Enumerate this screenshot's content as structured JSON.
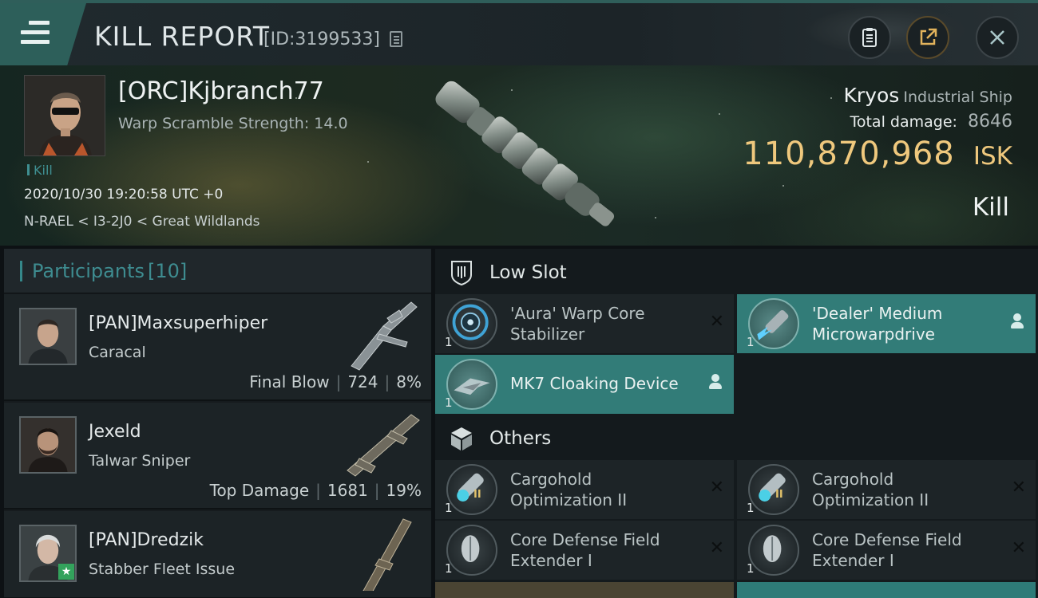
{
  "header": {
    "title": "KILL REPORT",
    "report_id": "[ID:3199533]"
  },
  "victim": {
    "name": "[ORC]Kjbranch77",
    "warp_scramble": "Warp Scramble Strength: 14.0",
    "tag": "Kill",
    "datetime": "2020/10/30 19:20:58 UTC +0",
    "location": "N-RAEL < I3-2J0 < Great Wildlands",
    "ship_name": "Kryos",
    "ship_class": "Industrial Ship",
    "total_damage_label": "Total damage:",
    "total_damage": "8646",
    "isk_value": "110,870,968",
    "isk_unit": "ISK",
    "result": "Kill"
  },
  "participants": {
    "label": "Participants",
    "count": "[10]",
    "items": [
      {
        "name": "[PAN]Maxsuperhiper",
        "ship": "Caracal",
        "role": "Final Blow",
        "damage": "724",
        "percent": "8%"
      },
      {
        "name": "Jexeld",
        "ship": "Talwar Sniper",
        "role": "Top Damage",
        "damage": "1681",
        "percent": "19%"
      },
      {
        "name": "[PAN]Dredzik",
        "ship": "Stabber Fleet Issue",
        "role": "",
        "damage": "",
        "percent": ""
      }
    ]
  },
  "low_slot": {
    "label": "Low Slot",
    "items": [
      {
        "name_line1": "'Aura' Warp Core",
        "name_line2": "Stabilizer",
        "qty": "1",
        "status": "destroyed"
      },
      {
        "name_line1": "'Dealer' Medium",
        "name_line2": "Microwarpdrive",
        "qty": "1",
        "status": "dropped"
      },
      {
        "name_line1": "MK7 Cloaking Device",
        "name_line2": "",
        "qty": "1",
        "status": "dropped"
      }
    ]
  },
  "others": {
    "label": "Others",
    "items": [
      {
        "name_line1": "Cargohold",
        "name_line2": "Optimization II",
        "qty": "1",
        "tier": "II",
        "status": "destroyed"
      },
      {
        "name_line1": "Cargohold",
        "name_line2": "Optimization II",
        "qty": "1",
        "tier": "II",
        "status": "destroyed"
      },
      {
        "name_line1": "Core Defense Field",
        "name_line2": "Extender I",
        "qty": "1",
        "status": "destroyed"
      },
      {
        "name_line1": "Core Defense Field",
        "name_line2": "Extender I",
        "qty": "1",
        "status": "destroyed"
      }
    ]
  },
  "colors": {
    "accent_teal": "#327c78",
    "isk_gold": "#efc87d",
    "participants_teal": "#3e8c90"
  },
  "icons": [
    "menu-icon",
    "copy-icon",
    "clipboard-icon",
    "share-icon",
    "close-icon",
    "shield-slot-icon",
    "cube-icon",
    "person-icon",
    "x-icon"
  ]
}
